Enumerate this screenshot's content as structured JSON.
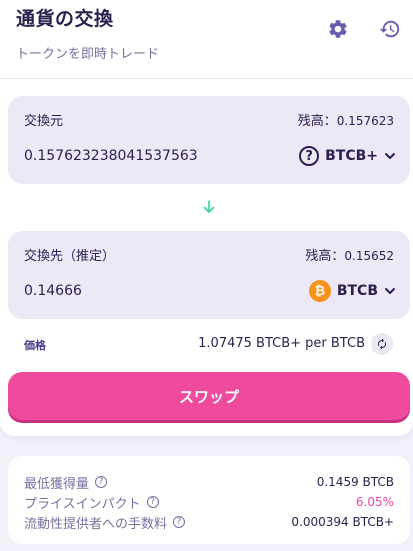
{
  "header": {
    "title": "通貨の交換",
    "subtitle": "トークンを即時トレード",
    "settings_icon": "gear-icon",
    "history_icon": "history-icon"
  },
  "from_panel": {
    "label": "交換元",
    "balance_label": "残高：",
    "balance_value": "0.157623",
    "amount": "0.157623238041537563",
    "token": "BTCB+",
    "token_icon": "unknown-token-icon"
  },
  "to_panel": {
    "label": "交換先（推定）",
    "balance_label": "残高：",
    "balance_value": "0.15652",
    "amount": "0.14666",
    "token": "BTCB",
    "token_icon": "bitcoin-icon"
  },
  "price": {
    "label": "価格",
    "value": "1.07475 BTCB+ per BTCB"
  },
  "swap_button": {
    "label": "スワップ"
  },
  "details": {
    "min_received": {
      "label": "最低獲得量",
      "value": "0.1459 BTCB"
    },
    "price_impact": {
      "label": "プライスインパクト",
      "value": "6.05%"
    },
    "lp_fee": {
      "label": "流動性提供者への手数料",
      "value": "0.000394 BTCB+"
    }
  },
  "colors": {
    "accent": "#ee4a9e",
    "panel_bg": "#ece8f6",
    "text": "#2a1f4d",
    "muted": "#7a6fa0",
    "arrow": "#31d0aa",
    "bitcoin": "#f7931a"
  }
}
